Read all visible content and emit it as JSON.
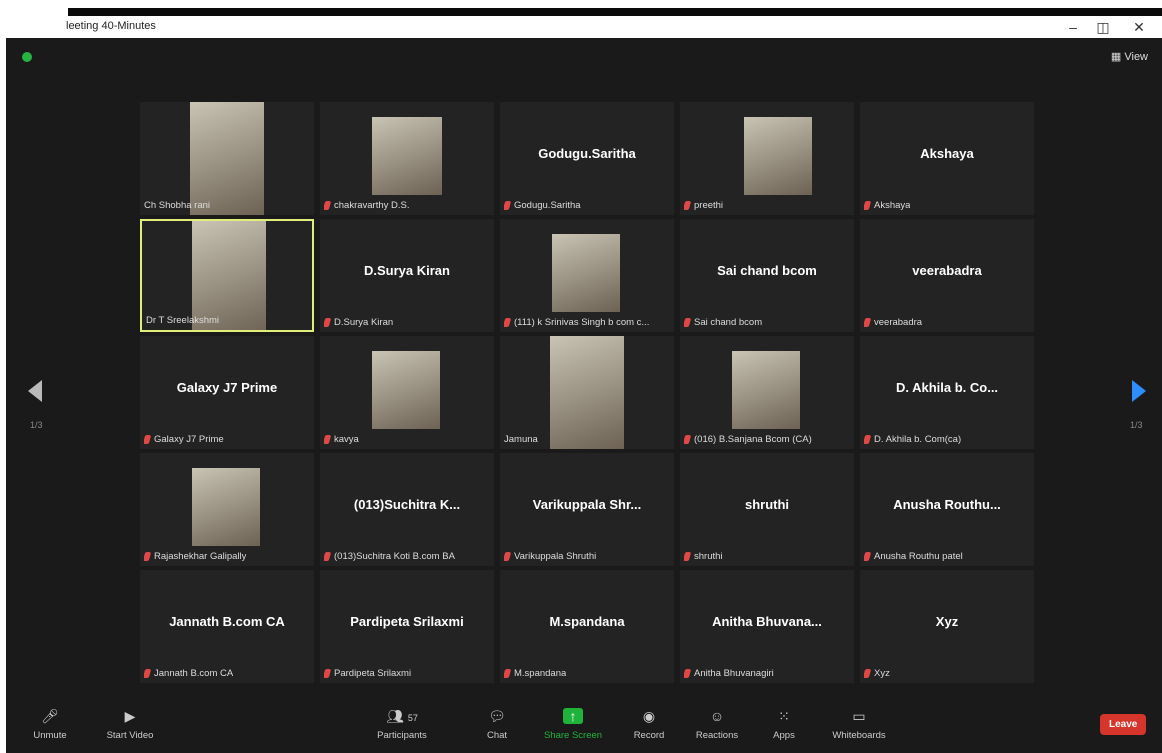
{
  "window": {
    "title": "leeting 40-Minutes",
    "min": "–",
    "max": "◫",
    "close": "✕"
  },
  "view": {
    "label": "▦ View"
  },
  "page": {
    "left": "1/3",
    "right": "1/3"
  },
  "tiles": [
    {
      "big": "",
      "name": "Ch Shobha rani",
      "muted": false,
      "video": true
    },
    {
      "big": "",
      "name": "chakravarthy D.S.",
      "muted": true,
      "video": true
    },
    {
      "big": "Godugu.Saritha",
      "name": "Godugu.Saritha",
      "muted": true,
      "video": false
    },
    {
      "big": "",
      "name": "preethi",
      "muted": true,
      "video": true
    },
    {
      "big": "Akshaya",
      "name": "Akshaya",
      "muted": true,
      "video": false
    },
    {
      "big": "",
      "name": "Dr T Sreelakshmi",
      "muted": false,
      "video": true,
      "active": true
    },
    {
      "big": "D.Surya Kiran",
      "name": "D.Surya Kiran",
      "muted": true,
      "video": false
    },
    {
      "big": "",
      "name": "(111) k Srinivas Singh b com c...",
      "muted": true,
      "video": true
    },
    {
      "big": "Sai chand bcom",
      "name": "Sai chand bcom",
      "muted": true,
      "video": false
    },
    {
      "big": "veerabadra",
      "name": "veerabadra",
      "muted": true,
      "video": false
    },
    {
      "big": "Galaxy J7 Prime",
      "name": "Galaxy J7 Prime",
      "muted": true,
      "video": false
    },
    {
      "big": "",
      "name": "kavya",
      "muted": true,
      "video": true
    },
    {
      "big": "",
      "name": "Jamuna",
      "muted": false,
      "video": true
    },
    {
      "big": "",
      "name": "(016) B.Sanjana Bcom (CA)",
      "muted": true,
      "video": true
    },
    {
      "big": "D. Akhila b. Co...",
      "name": "D. Akhila b. Com(ca)",
      "muted": true,
      "video": false
    },
    {
      "big": "",
      "name": "Rajashekhar Galipally",
      "muted": true,
      "video": true
    },
    {
      "big": "(013)Suchitra K...",
      "name": "(013)Suchitra Koti B.com BA",
      "muted": true,
      "video": false
    },
    {
      "big": "Varikuppala Shr...",
      "name": "Varikuppala Shruthi",
      "muted": true,
      "video": false
    },
    {
      "big": "shruthi",
      "name": "shruthi",
      "muted": true,
      "video": false
    },
    {
      "big": "Anusha Routhu...",
      "name": "Anusha Routhu patel",
      "muted": true,
      "video": false
    },
    {
      "big": "Jannath B.com CA",
      "name": "Jannath B.com CA",
      "muted": true,
      "video": false
    },
    {
      "big": "Pardipeta Srilaxmi",
      "name": "Pardipeta Srilaxmi",
      "muted": true,
      "video": false
    },
    {
      "big": "M.spandana",
      "name": "M.spandana",
      "muted": true,
      "video": false
    },
    {
      "big": "Anitha Bhuvana...",
      "name": "Anitha Bhuvanagiri",
      "muted": true,
      "video": false
    },
    {
      "big": "Xyz",
      "name": "Xyz",
      "muted": true,
      "video": false
    }
  ],
  "toolbar": {
    "unmute": "Unmute",
    "start_video": "Start Video",
    "participants": "Participants",
    "participants_count": "57",
    "chat": "Chat",
    "share": "Share Screen",
    "record": "Record",
    "reactions": "Reactions",
    "apps": "Apps",
    "whiteboards": "Whiteboards",
    "leave": "Leave"
  },
  "colors": {
    "accent": "#2d8cff",
    "share": "#1fb33c",
    "leave": "#d6352b",
    "active_border": "#e2ee7a"
  }
}
